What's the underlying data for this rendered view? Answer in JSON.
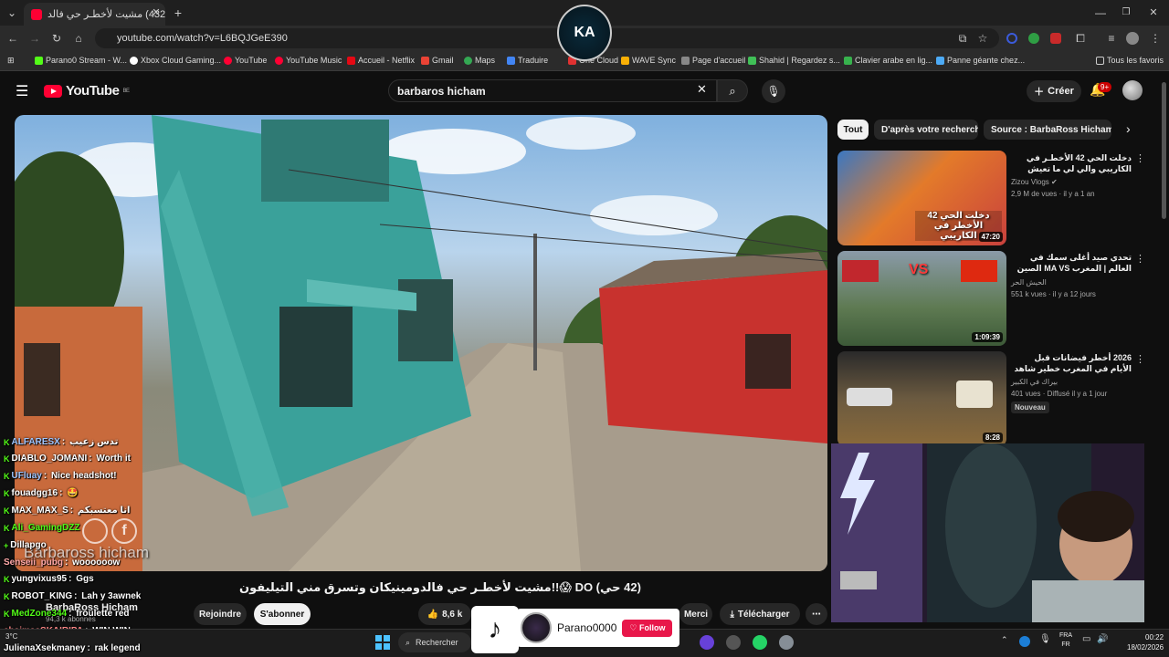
{
  "browser": {
    "tab_title": "(432) مشيت لأخطـر حي فالد",
    "url": "youtube.com/watch?v=L6BQJGeE390",
    "bookmarks": [
      "Parano0 Stream - W...",
      "Xbox Cloud Gaming...",
      "YouTube",
      "YouTube Music",
      "Accueil - Netflix",
      "Gmail",
      "Maps",
      "Traduire",
      "One Cloud",
      "WAVE Sync",
      "Page d'accueil",
      "Shahid | Regardez s...",
      "Clavier arabe en lig...",
      "Panne géante chez..."
    ],
    "all_favorites": "Tous les favoris"
  },
  "youtube": {
    "logo_text": "YouTube",
    "logo_region": "BE",
    "search_value": "barbaros hicham",
    "create_label": "Créer",
    "notif_count": "9+"
  },
  "chips": [
    "Tout",
    "D'après votre recherche",
    "Source : BarbaRoss Hicham"
  ],
  "recommendations": [
    {
      "title": "دخلت الحي 42 الأخطـر في الكاريبي والي لي ما تعيش زيارته",
      "channel": "Zizou Vlogs",
      "meta": "2,9 M de vues · il y a 1 an",
      "duration": "47:20",
      "thumb_text": "دخلت الحي 42 الأخطر في الكاريبي",
      "badge": ""
    },
    {
      "title": "تحدي صيد أغلى سمك في العالم | المغرب MA VS الصين CN",
      "channel": "الحيش الحر",
      "meta": "551 k vues · il y a 12 jours",
      "duration": "1:09:39",
      "thumb_text": "VS",
      "badge": ""
    },
    {
      "title": "2026 أخطر فيضانات قبل الأيام في المغرب خطير شاهد فيضانات تغرق القصر الكبير",
      "channel": "بيراك في الكبير",
      "meta": "401 vues · Diffusé il y a 1 jour",
      "duration": "8:28",
      "thumb_text": "",
      "badge": "Nouveau"
    }
  ],
  "video": {
    "title": "(42 حي) DO 😱!!مشيت لأخطـر حي فالدومينيكان وتسرق مني التيليفون",
    "watermark": "Barbaross hicham",
    "channel_name": "BarbaRoss Hicham",
    "channel_subs": "94,3 k abonnés",
    "join_label": "Rejoindre",
    "subscribe_label": "S'abonner",
    "likes": "8,6 k",
    "thanks_label": "Merci",
    "download_label": "Télécharger"
  },
  "chat": [
    {
      "user": "ALFARESX",
      "msg": "تدس زعيب"
    },
    {
      "user": "DIABLO_JOMANI",
      "msg": "Worth it"
    },
    {
      "user": "UFluay",
      "msg": "Nice headshot!"
    },
    {
      "user": "fouadgg16",
      "msg": "🤩"
    },
    {
      "user": "MAX_MAX_S",
      "msg": "انا معتسبكم"
    },
    {
      "user": "Ali_GamingDZZ",
      "msg": ""
    },
    {
      "user": "Dillapgo",
      "msg": ""
    },
    {
      "user": "Senseii_pubg",
      "msg": "woooooow"
    },
    {
      "user": "yungvixus95",
      "msg": "Ggs"
    },
    {
      "user": "ROBOT_KING",
      "msg": "Lah y 3awnek"
    },
    {
      "user": "MedZone344",
      "msg": "froulette red"
    },
    {
      "user": "chaimaaSKAIRIPA",
      "msg": "WIN WIN"
    },
    {
      "user": "JulienaXsekmaney",
      "msg": "rak legend"
    }
  ],
  "overlay": {
    "streamer": "Parano0000",
    "follow_label": "Follow",
    "logo_text": "KA"
  },
  "taskbar": {
    "search_label": "Rechercher",
    "lang": "FRA",
    "lang2": "FR",
    "time": "00:22",
    "date": "18/02/2026",
    "weather": "3°C"
  }
}
